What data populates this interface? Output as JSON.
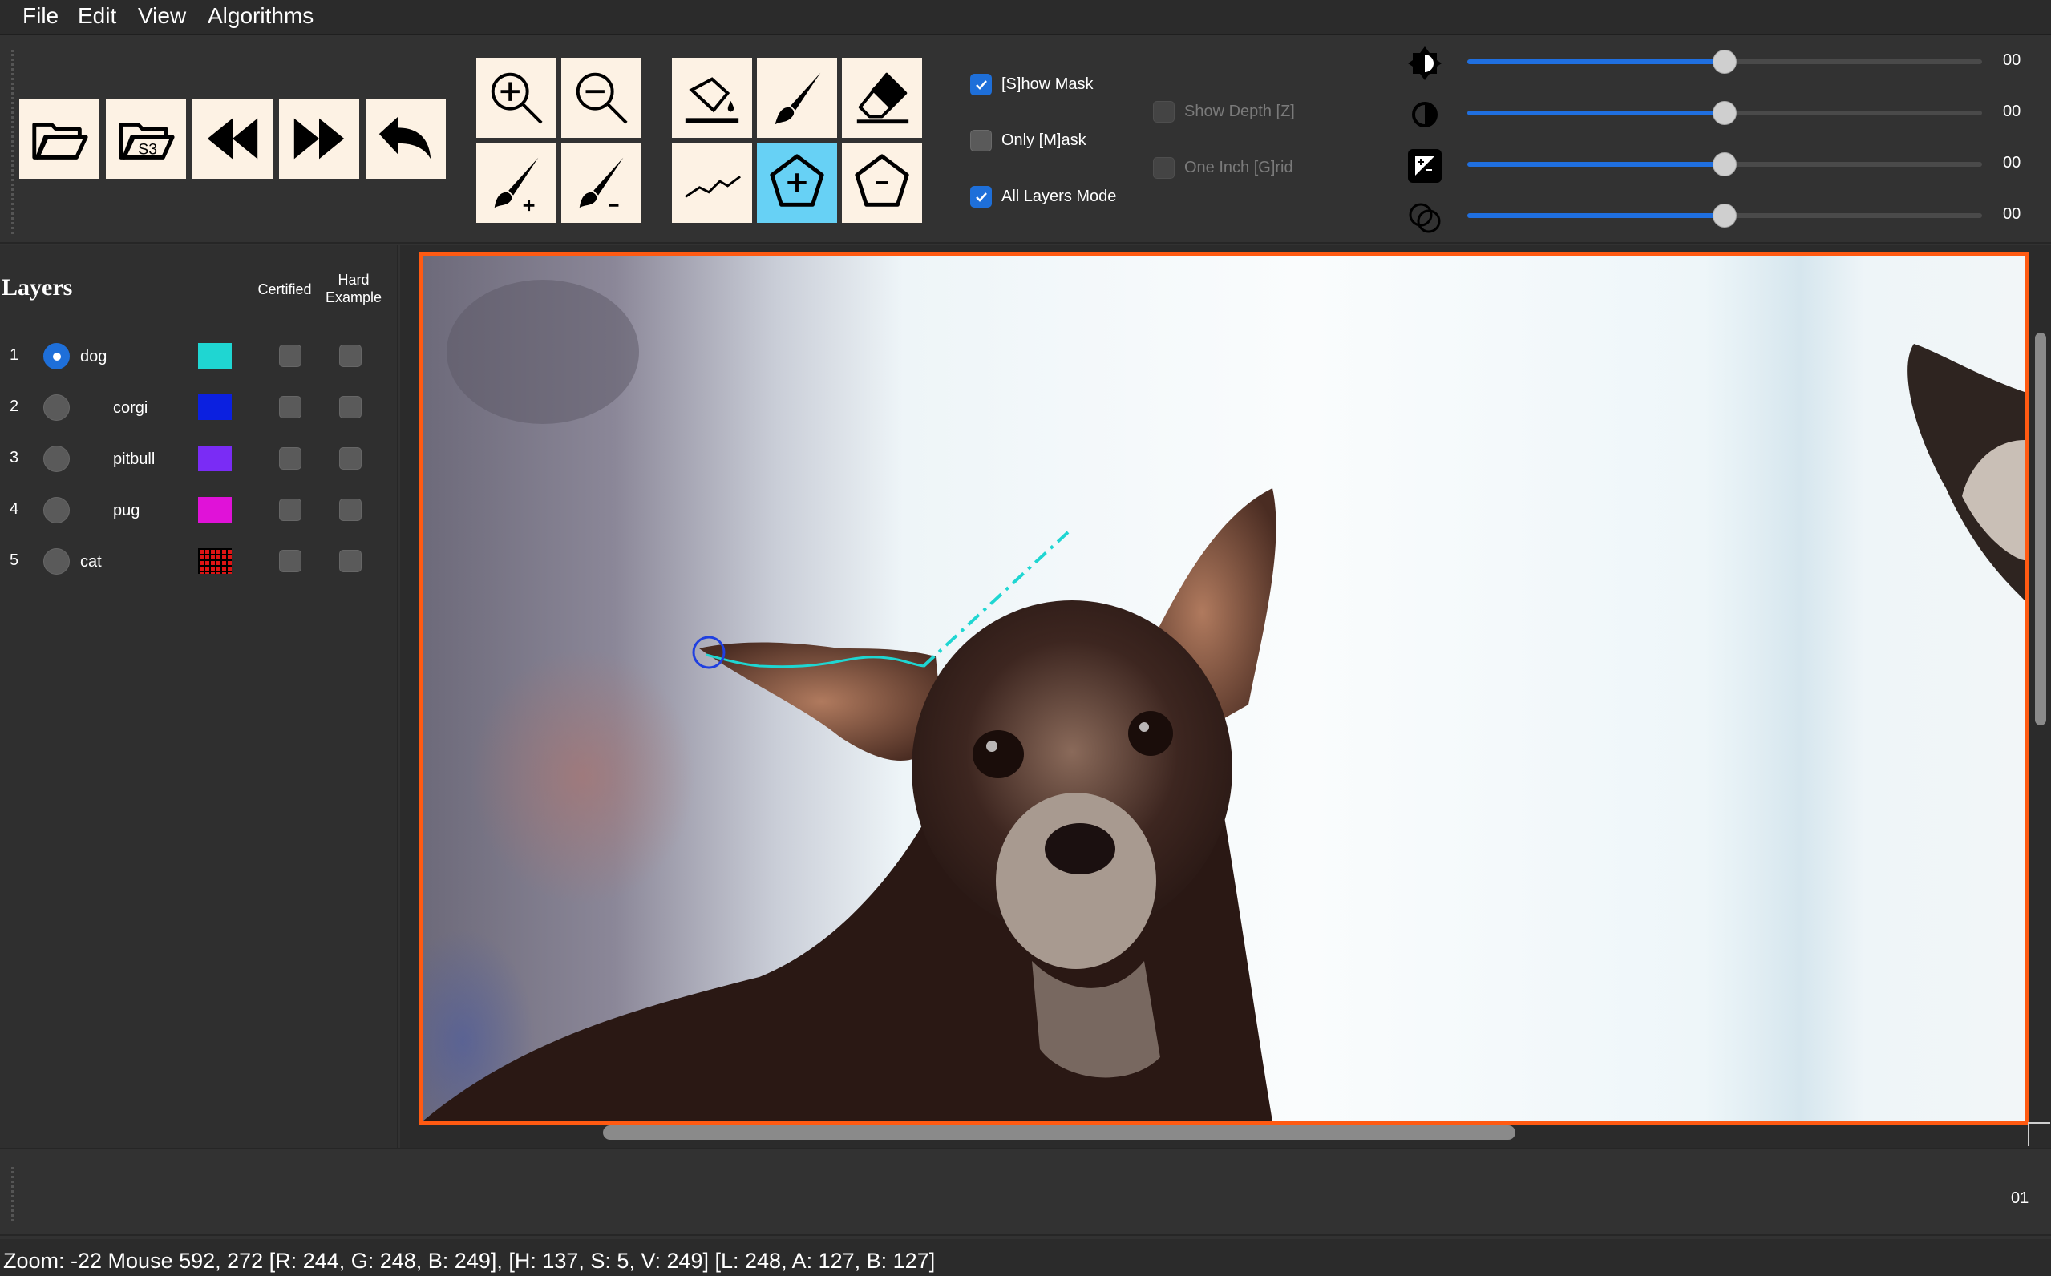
{
  "menu": {
    "items": [
      "File",
      "Edit",
      "View",
      "Algorithms"
    ]
  },
  "toolbar": {
    "file_buttons": [
      "open-folder-icon",
      "s3-folder-icon",
      "previous-image-icon",
      "next-image-icon",
      "undo-icon"
    ],
    "s3_label": "S3",
    "zoom_buttons": [
      "zoom-in-icon",
      "zoom-out-icon",
      "brush-plus-icon",
      "brush-minus-icon"
    ],
    "tool_buttons": [
      "fill-bucket-icon",
      "brush-icon",
      "eraser-icon",
      "polyline-icon",
      "polygon-add-icon",
      "polygon-subtract-icon"
    ],
    "active_tool": "polygon-add-icon",
    "active_color": "#67d1f5",
    "checkboxes": {
      "show_mask": {
        "label": "[S]how Mask",
        "checked": true
      },
      "only_mask": {
        "label": "Only [M]ask",
        "checked": false
      },
      "all_layers": {
        "label": "All Layers Mode",
        "checked": true
      },
      "show_depth": {
        "label": "Show Depth [Z]",
        "checked": false,
        "disabled": true
      },
      "one_inch_grid": {
        "label": "One Inch [G]rid",
        "checked": false,
        "disabled": true
      }
    },
    "sliders": [
      {
        "icon": "brightness-icon",
        "value": "00",
        "level": 0.5
      },
      {
        "icon": "contrast-icon",
        "value": "00",
        "level": 0.5
      },
      {
        "icon": "exposure-icon",
        "value": "00",
        "level": 0.5
      },
      {
        "icon": "overlay-opacity-icon",
        "value": "00",
        "level": 0.5
      }
    ]
  },
  "layers": {
    "title": "Layers",
    "col_certified": "Certified",
    "col_hard": "Hard",
    "col_example": "Example",
    "items": [
      {
        "num": "1",
        "name": "dog",
        "color": "#1fd6d2",
        "selected": true
      },
      {
        "num": "2",
        "name": "corgi",
        "color": "#0b20e0",
        "selected": false
      },
      {
        "num": "3",
        "name": "pitbull",
        "color": "#7a2cf5",
        "selected": false
      },
      {
        "num": "4",
        "name": "pug",
        "color": "#e012d8",
        "selected": false
      },
      {
        "num": "5",
        "name": "cat",
        "color": "#e01414",
        "selected": false,
        "pattern": "grid"
      }
    ]
  },
  "canvas": {
    "frame_color": "#ff5a12",
    "annotation_color": "#1fd6d2",
    "cursor_color": "#2040e0"
  },
  "lower": {
    "value": "01"
  },
  "status": {
    "text": "Zoom: -22 Mouse 592, 272  [R: 244, G: 248, B: 249], [H: 137, S: 5, V: 249] [L: 248, A: 127, B: 127]"
  }
}
